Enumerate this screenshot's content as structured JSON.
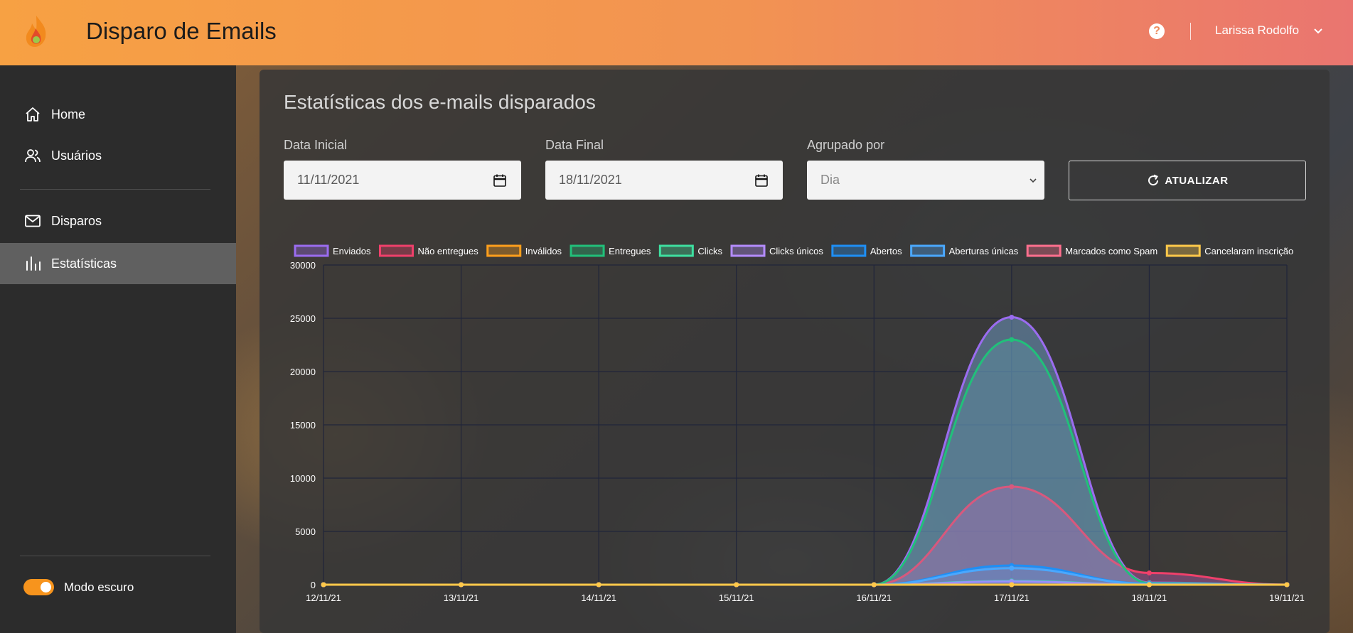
{
  "header": {
    "title": "Disparo de Emails",
    "help": "?",
    "user_name": "Larissa Rodolfo"
  },
  "sidebar": {
    "items": [
      {
        "label": "Home",
        "icon": "home-icon"
      },
      {
        "label": "Usuários",
        "icon": "users-icon"
      },
      {
        "label": "Disparos",
        "icon": "mail-icon"
      },
      {
        "label": "Estatísticas",
        "icon": "bar-chart-icon",
        "active": true
      }
    ],
    "dark_mode_label": "Modo escuro",
    "dark_mode_on": true
  },
  "main": {
    "title": "Estatísticas dos e-mails disparados",
    "filters": {
      "start_label": "Data Inicial",
      "start_value": "11/11/2021",
      "end_label": "Data Final",
      "end_value": "18/11/2021",
      "group_label": "Agrupado por",
      "group_value": "Dia"
    },
    "refresh_label": "ATUALIZAR"
  },
  "colors": {
    "accent": "#f7941d",
    "header_start": "#f7a143",
    "header_end": "#ea7570"
  },
  "chart_data": {
    "type": "area",
    "x": [
      "12/11/21",
      "13/11/21",
      "14/11/21",
      "15/11/21",
      "16/11/21",
      "17/11/21",
      "18/11/21",
      "19/11/21"
    ],
    "ylim": [
      0,
      30000
    ],
    "yticks": [
      0,
      5000,
      10000,
      15000,
      20000,
      25000,
      30000
    ],
    "grid": true,
    "legend": "top",
    "series": [
      {
        "name": "Enviados",
        "color": "#9b6cf0",
        "values": [
          0,
          0,
          0,
          0,
          0,
          25100,
          200,
          0
        ]
      },
      {
        "name": "Não entregues",
        "color": "#f0406b",
        "values": [
          0,
          0,
          0,
          0,
          0,
          9200,
          1100,
          0
        ]
      },
      {
        "name": "Inválidos",
        "color": "#ff9f1c",
        "values": [
          0,
          0,
          0,
          0,
          0,
          0,
          0,
          0
        ]
      },
      {
        "name": "Entregues",
        "color": "#21c07a",
        "values": [
          0,
          0,
          0,
          0,
          0,
          23000,
          150,
          0
        ]
      },
      {
        "name": "Clicks",
        "color": "#3ee0a0",
        "values": [
          0,
          0,
          0,
          0,
          0,
          350,
          0,
          0
        ]
      },
      {
        "name": "Clicks únicos",
        "color": "#b48cff",
        "values": [
          0,
          0,
          0,
          0,
          0,
          300,
          0,
          0
        ]
      },
      {
        "name": "Abertos",
        "color": "#1e8ff5",
        "values": [
          0,
          0,
          0,
          0,
          0,
          1800,
          100,
          0
        ]
      },
      {
        "name": "Aberturas únicas",
        "color": "#4aa8ff",
        "values": [
          0,
          0,
          0,
          0,
          0,
          1550,
          90,
          0
        ]
      },
      {
        "name": "Marcados como Spam",
        "color": "#ff6f8e",
        "values": [
          0,
          0,
          0,
          0,
          0,
          0,
          0,
          0
        ]
      },
      {
        "name": "Cancelaram inscrição",
        "color": "#ffc94a",
        "values": [
          0,
          0,
          0,
          0,
          0,
          0,
          0,
          0
        ]
      }
    ]
  }
}
